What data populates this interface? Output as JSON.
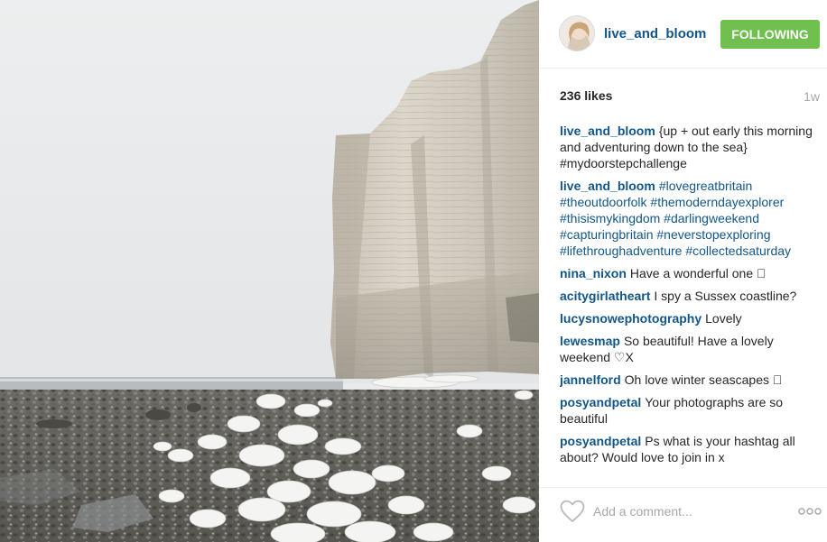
{
  "post": {
    "username": "live_and_bloom",
    "follow_label": "FOLLOWING",
    "likes": "236 likes",
    "time_ago": "1w"
  },
  "comments": [
    {
      "user": "live_and_bloom",
      "text": "{up + out early this morning and adventuring down to the sea} #mydoorstepchallenge",
      "hashtags": false
    },
    {
      "user": "live_and_bloom",
      "text": "#lovegreatbritain #theoutdoorfolk #themoderndayexplorer #thisismykingdom #darlingweekend #capturingbritain #neverstopexploring #lifethroughadventure #collectedsaturday",
      "hashtags": true
    },
    {
      "user": "nina_nixon",
      "text": "Have a wonderful one 🏼",
      "hashtags": false
    },
    {
      "user": "acitygirlatheart",
      "text": "I spy a Sussex coastline?",
      "hashtags": false
    },
    {
      "user": "lucysnowephotography",
      "text": "Lovely",
      "hashtags": false
    },
    {
      "user": "lewesmap",
      "text": "So beautiful! Have a lovely weekend ♡X",
      "hashtags": false
    },
    {
      "user": "jannelford",
      "text": "Oh love winter seascapes 🏼",
      "hashtags": false
    },
    {
      "user": "posyandpetal",
      "text": "Your photographs are so beautiful",
      "hashtags": false
    },
    {
      "user": "posyandpetal",
      "text": "Ps what is your hashtag all about? Would love to join in x",
      "hashtags": false
    }
  ],
  "footer": {
    "comment_placeholder": "Add a comment...",
    "like_icon": "heart-outline-icon",
    "more_icon": "ellipsis-icon"
  },
  "colors": {
    "username_blue": "#125688",
    "follow_green": "#70c050",
    "muted_gray": "#a5a7aa"
  }
}
